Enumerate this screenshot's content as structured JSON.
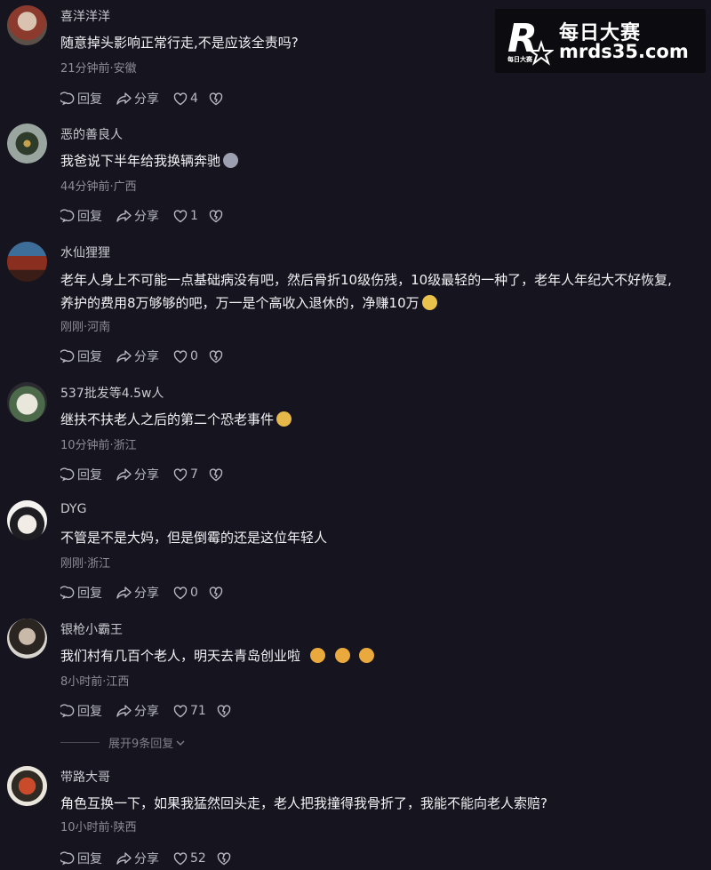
{
  "watermark": {
    "brand_cn": "每日大赛",
    "url": "mrds35.com",
    "logo_letter": "R",
    "logo_small": "每日大赛"
  },
  "comments": [
    {
      "username": "喜洋洋洋",
      "lines": [
        "随意掉头影响正常行走,不是应该全责吗?"
      ],
      "meta": "21分钟前·安徽",
      "reply": "回复",
      "share": "分享",
      "likes": "4"
    },
    {
      "username": "恶的善良人",
      "lines": [
        "我爸说下半年给我换辆奔驰"
      ],
      "meta": "44分钟前·广西",
      "reply": "回复",
      "share": "分享",
      "likes": "1"
    },
    {
      "username": "水仙狸狸",
      "lines": [
        "老年人身上不可能一点基础病没有吧，然后骨折10级伤残，10级最轻的一种了，老年人年纪大不好恢复,",
        "养护的费用8万够够的吧，万一是个高收入退休的，净赚10万"
      ],
      "meta": "刚刚·河南",
      "reply": "回复",
      "share": "分享",
      "likes": "0"
    },
    {
      "username": "537批发等4.5w人",
      "lines": [
        "继扶不扶老人之后的第二个恐老事件"
      ],
      "meta": "10分钟前·浙江",
      "reply": "回复",
      "share": "分享",
      "likes": "7"
    },
    {
      "username": "DYG",
      "lines": [
        "不管是不是大妈，但是倒霉的还是这位年轻人"
      ],
      "meta": "刚刚·浙江",
      "reply": "回复",
      "share": "分享",
      "likes": "0"
    },
    {
      "username": "银枪小霸王",
      "lines": [
        "我们村有几百个老人，明天去青岛创业啦"
      ],
      "meta": "8小时前·江西",
      "reply": "回复",
      "share": "分享",
      "likes": "71"
    },
    {
      "username": "带路大哥",
      "lines": [
        "角色互换一下，如果我猛然回头走，老人把我撞得我骨折了，我能不能向老人索赔?"
      ],
      "meta": "10小时前·陕西",
      "reply": "回复",
      "share": "分享",
      "likes": "52"
    }
  ],
  "expand_replies": "展开9条回复",
  "colors": {
    "background": "#15141f",
    "text": "#f2f2f5",
    "meta": "#8d8c97",
    "action": "#b8b8c2"
  }
}
